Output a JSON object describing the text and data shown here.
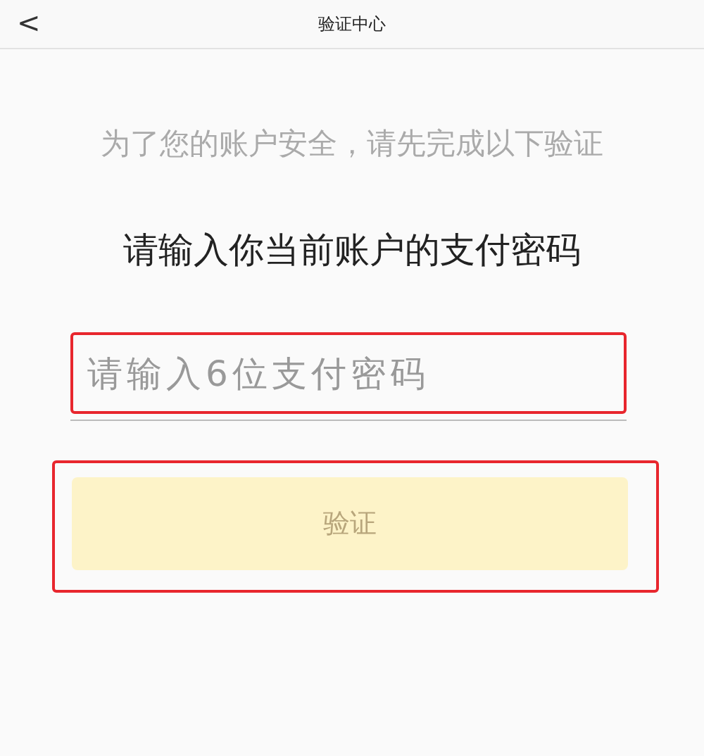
{
  "top_bar": {
    "back": "<",
    "title": "验证中心"
  },
  "prompt": "为了您的账户安全，请先完成以下验证",
  "heading": "请输入你当前账户的支付密码",
  "password_field": {
    "placeholder": "请输入6位支付密码",
    "highlighted": true
  },
  "verify_button": {
    "label": "验证",
    "disabled": true,
    "highlighted": true
  }
}
